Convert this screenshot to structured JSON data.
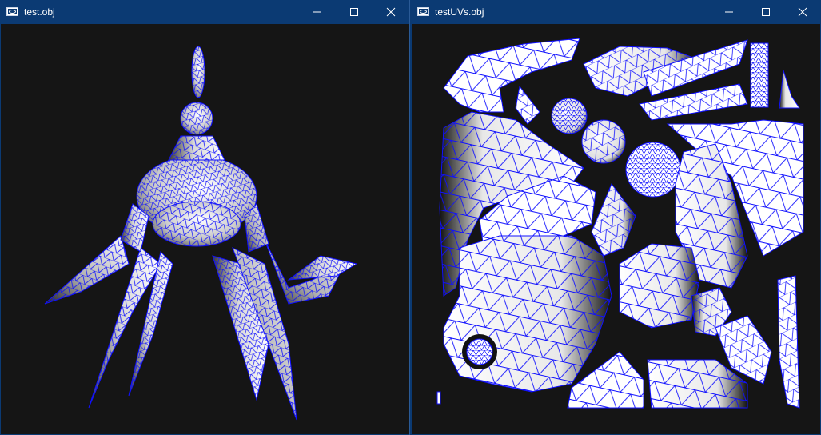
{
  "windows": [
    {
      "title": "test.obj",
      "icon": "app-window-icon",
      "controls": [
        "minimize-icon",
        "maximize-icon",
        "close-icon"
      ],
      "viewport": "3d-mesh-render"
    },
    {
      "title": "testUVs.obj",
      "icon": "app-window-icon",
      "controls": [
        "minimize-icon",
        "maximize-icon",
        "close-icon"
      ],
      "viewport": "uv-layout-render"
    }
  ],
  "colors": {
    "titlebar": "#0b3a73",
    "viewport_background": "#151515",
    "wireframe": "#1010ff",
    "mesh_fill": "#ffffff"
  }
}
